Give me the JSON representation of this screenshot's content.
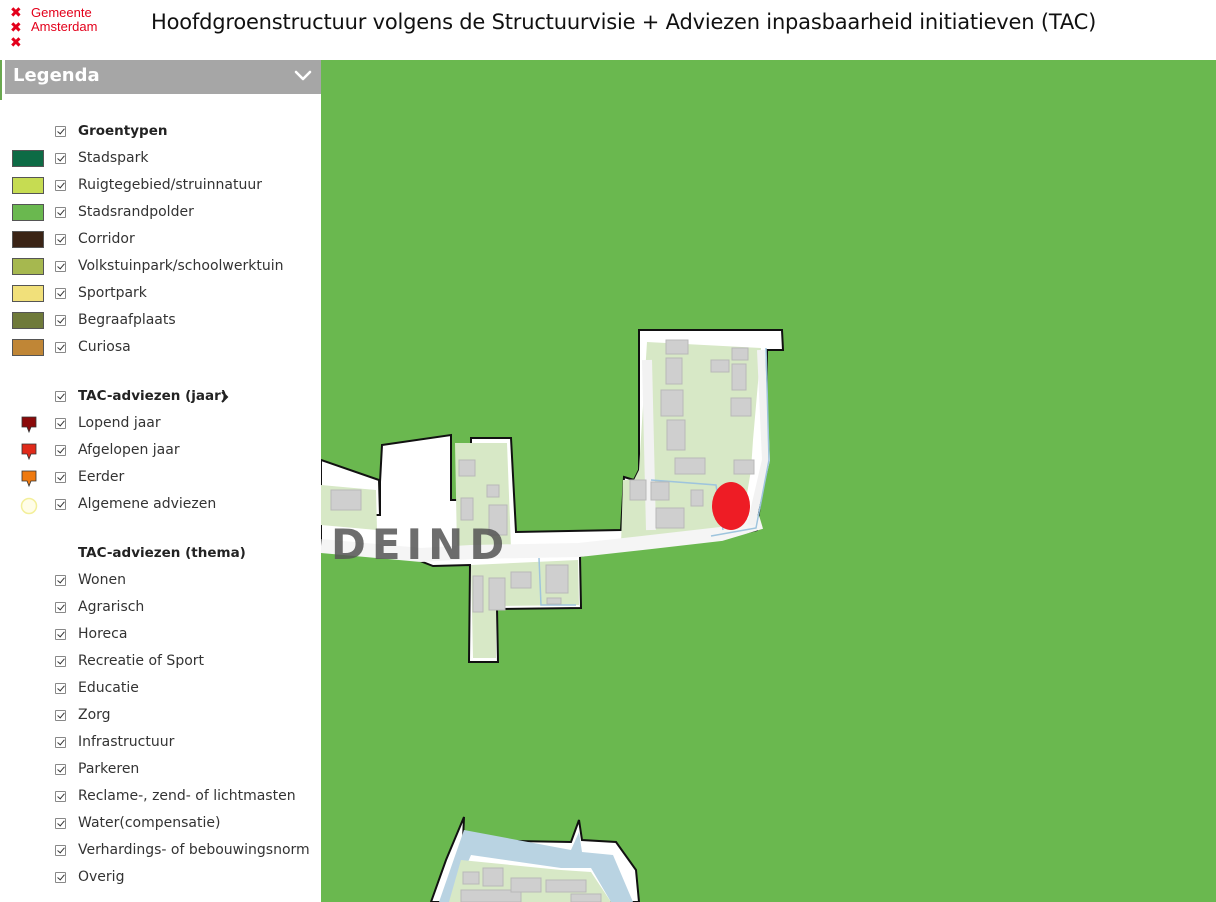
{
  "header": {
    "logo_line1": "Gemeente",
    "logo_line2": "Amsterdam",
    "title": "Hoofdgroenstructuur volgens de Structuurvisie + Adviezen inpasbaarheid initiatieven (TAC)"
  },
  "legend": {
    "title": "Legenda",
    "groentypen": {
      "heading": "Groentypen",
      "items": [
        {
          "label": "Stadspark",
          "color": "#0d6b45"
        },
        {
          "label": "Ruigtegebied/struinnatuur",
          "color": "#c6dc52"
        },
        {
          "label": "Stadsrandpolder",
          "color": "#6ab84f"
        },
        {
          "label": "Corridor",
          "color": "#3b2416"
        },
        {
          "label": "Volkstuinpark/schoolwerktuin",
          "color": "#a6b84f"
        },
        {
          "label": "Sportpark",
          "color": "#f1e07a"
        },
        {
          "label": "Begraafplaats",
          "color": "#6f7a3a"
        },
        {
          "label": "Curiosa",
          "color": "#c08636"
        }
      ]
    },
    "tac_jaar": {
      "heading": "TAC-adviezen (jaar)",
      "items": [
        {
          "label": "Lopend jaar",
          "color": "#8b0a0a",
          "icon": "marker-dark-red-icon"
        },
        {
          "label": "Afgelopen jaar",
          "color": "#e02a1a",
          "icon": "marker-red-icon"
        },
        {
          "label": "Eerder",
          "color": "#ef7a10",
          "icon": "marker-orange-icon"
        },
        {
          "label": "Algemene adviezen",
          "color": "#f3ef9a",
          "icon": "circle-yellow-icon"
        }
      ]
    },
    "tac_thema": {
      "heading": "TAC-adviezen (thema)",
      "items": [
        {
          "label": "Wonen"
        },
        {
          "label": "Agrarisch"
        },
        {
          "label": "Horeca"
        },
        {
          "label": "Recreatie of Sport"
        },
        {
          "label": "Educatie"
        },
        {
          "label": "Zorg"
        },
        {
          "label": "Infrastructuur"
        },
        {
          "label": "Parkeren"
        },
        {
          "label": "Reclame-, zend- of lichtmasten"
        },
        {
          "label": "Water(compensatie)"
        },
        {
          "label": "Verhardings- of bebouwingsnorm"
        },
        {
          "label": "Overig"
        }
      ]
    }
  },
  "map": {
    "place_label": "DEIND",
    "background_color": "#6ab84f",
    "marker_color": "#ee1c25"
  }
}
